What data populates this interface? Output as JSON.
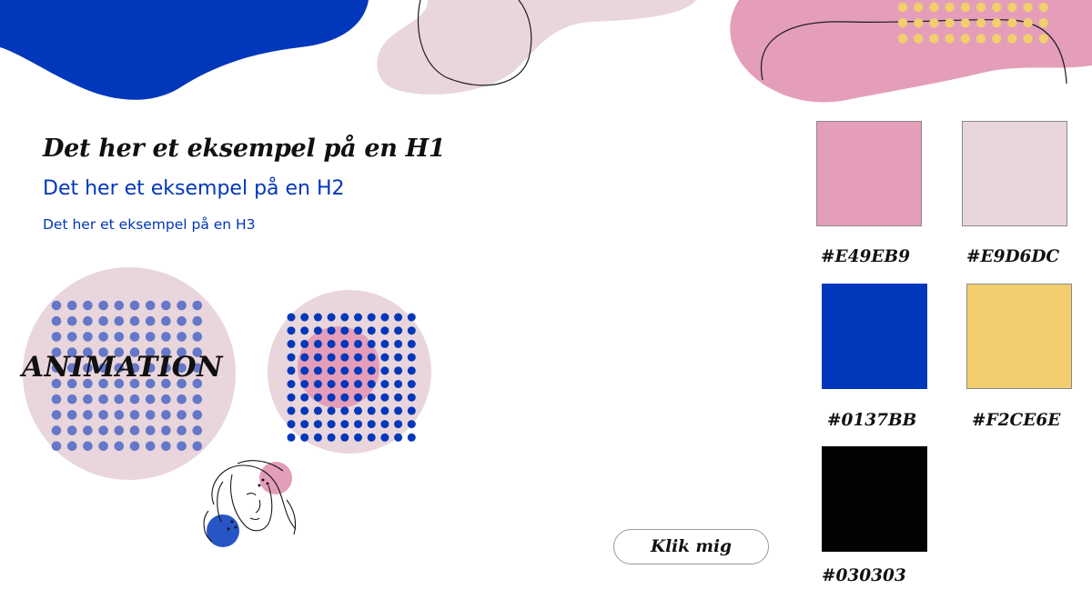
{
  "headings": {
    "h1": "Det her et eksempel på en H1",
    "h2": "Det her et eksempel på en H2",
    "h3": "Det her et eksempel på en H3"
  },
  "animation_label": "ANIMATION",
  "button": {
    "label": "Klik mig"
  },
  "palette": [
    {
      "hex_label": "#E49EB9",
      "color": "#E49EB9"
    },
    {
      "hex_label": "#E9D6DC",
      "color": "#E9D6DC"
    },
    {
      "hex_label": "#0137BB",
      "color": "#0137BB"
    },
    {
      "hex_label": "#F2CE6E",
      "color": "#F2CE6E"
    },
    {
      "hex_label": "#030303",
      "color": "#030303"
    }
  ],
  "colors": {
    "blue": "#0137BB",
    "pink": "#E49EB9",
    "light_pink": "#E9D6DC",
    "yellow": "#F2CE6E",
    "black": "#030303",
    "dot_blue": "#6477C8"
  },
  "icons": [
    "woman-face-illustration"
  ]
}
